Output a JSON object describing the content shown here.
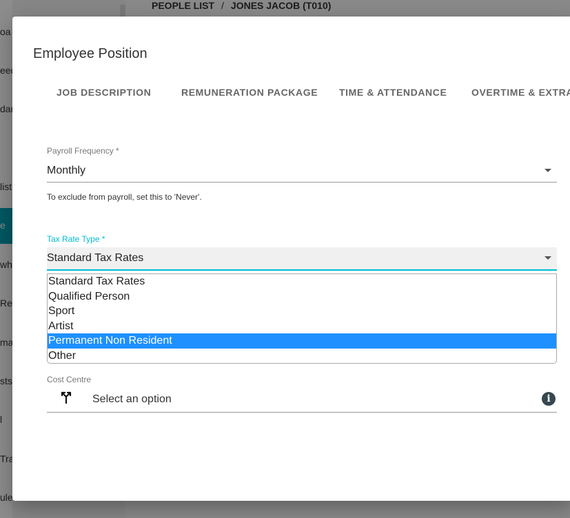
{
  "background": {
    "breadcrumb": [
      "PEOPLE LIST",
      "JONES JACOB (T010)"
    ],
    "breadcrumb_separator": "/",
    "sidebar_fragments": [
      "oa",
      "eed",
      "dar",
      "list",
      "e",
      "wh",
      "Re",
      "ma",
      "sts",
      "l",
      "Tra",
      "ule"
    ]
  },
  "dialog": {
    "title": "Employee Position",
    "tabs": [
      "JOB DESCRIPTION",
      "REMUNERATION PACKAGE",
      "TIME & ATTENDANCE",
      "OVERTIME & EXTRA"
    ]
  },
  "payroll_frequency": {
    "label": "Payroll Frequency *",
    "value": "Monthly",
    "hint": "To exclude from payroll, set this to 'Never'."
  },
  "tax_rate_type": {
    "label": "Tax Rate Type *",
    "value": "Standard Tax Rates",
    "options": [
      "Standard Tax Rates",
      "Qualified Person",
      "Sport",
      "Artist",
      "Permanent Non Resident",
      "Other"
    ],
    "highlighted_option": "Permanent Non Resident"
  },
  "cost_centre": {
    "label": "Cost Centre",
    "placeholder": "Select an option",
    "icon": "split-arrow-icon",
    "info_icon": "info-icon"
  },
  "colors": {
    "accent": "#00bcd4",
    "sidebar_active": "#00a3b4",
    "option_highlight": "#1e90ff",
    "info_icon": "#37474f"
  }
}
